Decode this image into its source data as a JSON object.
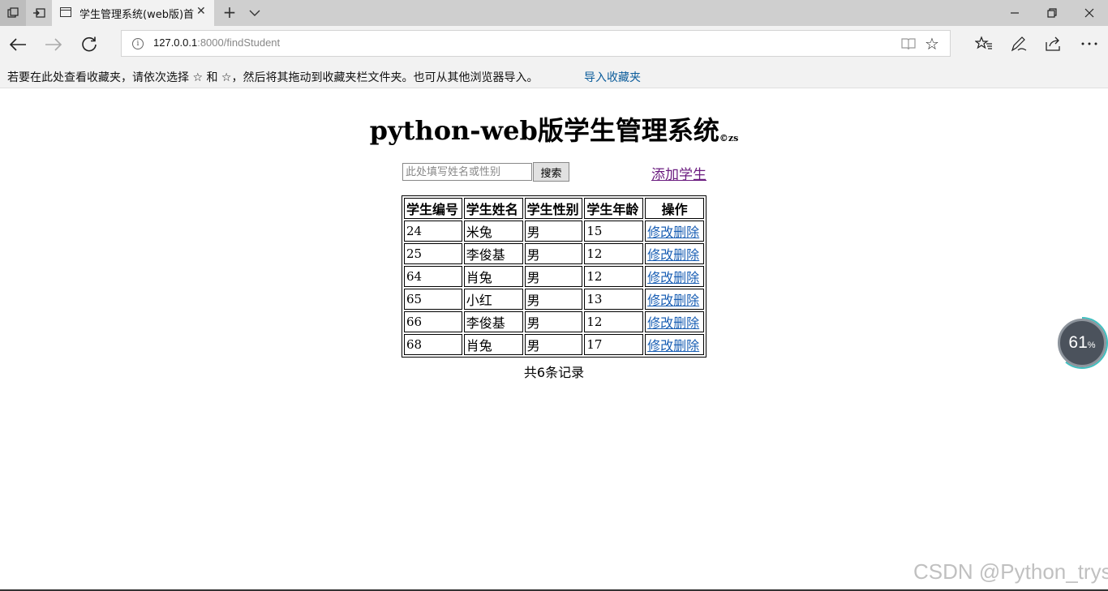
{
  "tab": {
    "title": "学生管理系统(web版)首"
  },
  "address": {
    "host": "127.0.0.1",
    "rest": ":8000/findStudent"
  },
  "favorites_bar": {
    "message": "若要在此处查看收藏夹，请依次选择 ☆ 和 ☆，然后将其拖动到收藏夹栏文件夹。也可从其他浏览器导入。",
    "import_link": "导入收藏夹"
  },
  "page": {
    "title": "python-web版学生管理系统",
    "title_mark": "©zs",
    "search_placeholder": "此处填写姓名或性别",
    "search_button": "搜索",
    "add_link": "添加学生",
    "headers": [
      "学生编号",
      "学生姓名",
      "学生性别",
      "学生年龄",
      "操作"
    ],
    "rows": [
      {
        "id": "24",
        "name": "米兔",
        "gender": "男",
        "age": "15"
      },
      {
        "id": "25",
        "name": "李俊基",
        "gender": "男",
        "age": "12"
      },
      {
        "id": "64",
        "name": "肖兔",
        "gender": "男",
        "age": "12"
      },
      {
        "id": "65",
        "name": "小红",
        "gender": "男",
        "age": "13"
      },
      {
        "id": "66",
        "name": "李俊基",
        "gender": "男",
        "age": "12"
      },
      {
        "id": "68",
        "name": "肖兔",
        "gender": "男",
        "age": "17"
      }
    ],
    "edit_label": "修改",
    "delete_label": "删除",
    "total": "共6条记录"
  },
  "widget": {
    "value": "61",
    "unit": "%"
  },
  "watermark": "CSDN @Python_trys"
}
